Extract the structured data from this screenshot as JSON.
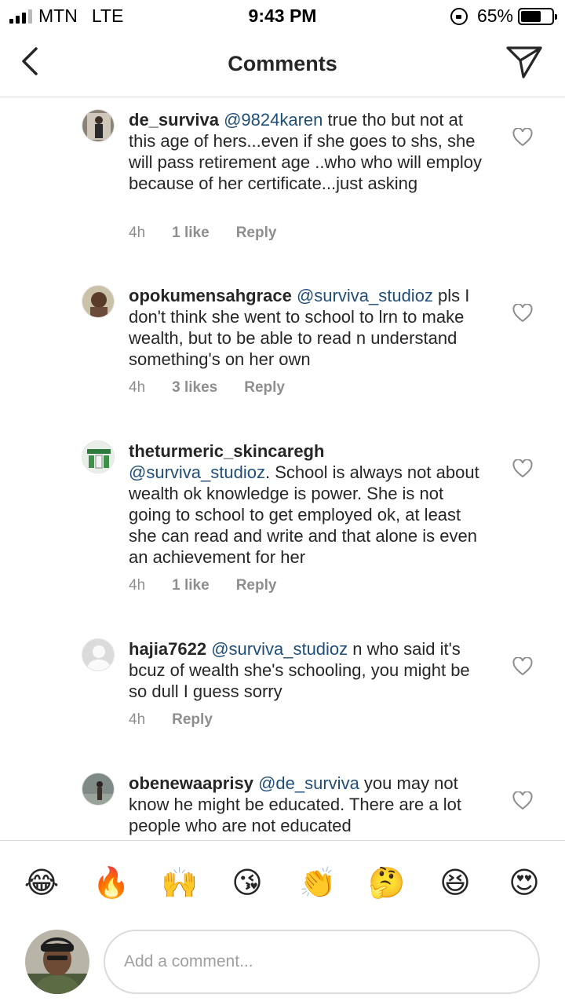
{
  "status_bar": {
    "carrier": "MTN",
    "network": "LTE",
    "time": "9:43 PM",
    "battery": "65%",
    "battery_level": 0.65
  },
  "header": {
    "title": "Comments"
  },
  "comments": [
    {
      "username": "de_surviva",
      "mention": "@9824karen",
      "text": " true tho but not at this age of hers...even if she goes to shs, she will pass retirement age ..who who will employ because of her certificate...just asking",
      "time": "4h",
      "likes": "1 like",
      "reply": "Reply"
    },
    {
      "username": "opokumensahgrace",
      "mention": "@surviva_studioz",
      "text": " pls I don't think she went to school to lrn to make wealth, but to be able to read n understand something's on her own",
      "time": "4h",
      "likes": "3 likes",
      "reply": "Reply"
    },
    {
      "username": "theturmeric_skincaregh",
      "mention": "@surviva_studioz",
      "text": ". School is always not about wealth ok knowledge is power. She is not going to school to get employed ok, at least she can read and write and that alone is even an achievement for her",
      "time": "4h",
      "likes": "1 like",
      "reply": "Reply"
    },
    {
      "username": "hajia7622",
      "mention": "@surviva_studioz",
      "text": " n who said it's bcuz of wealth she's schooling, you might be so dull I guess sorry",
      "time": "4h",
      "likes": "",
      "reply": "Reply"
    },
    {
      "username": "obenewaaprisy",
      "mention": "@de_surviva",
      "text": " you may not know he might be educated. There are a lot people who are not educated",
      "time": "",
      "likes": "",
      "reply": ""
    }
  ],
  "emojis": [
    "😂",
    "🔥",
    "🙌",
    "😘",
    "👏",
    "🤔",
    "😆",
    "😍"
  ],
  "input": {
    "placeholder": "Add a comment..."
  }
}
